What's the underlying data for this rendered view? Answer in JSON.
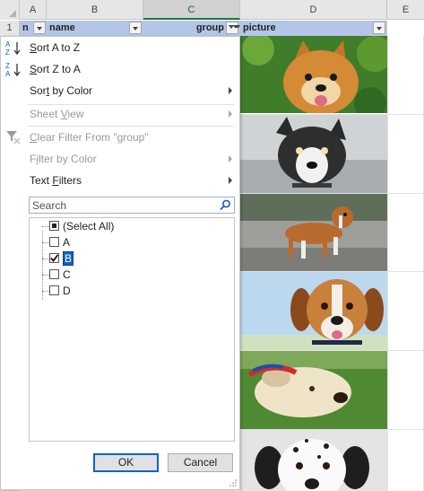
{
  "columns": [
    {
      "letter": ""
    },
    {
      "letter": "A"
    },
    {
      "letter": "B"
    },
    {
      "letter": "C"
    },
    {
      "letter": "D"
    },
    {
      "letter": "E"
    }
  ],
  "header_row": {
    "row_number": "1",
    "col_a": "n",
    "col_b": "name",
    "col_c": "group",
    "col_d": "picture"
  },
  "menu": {
    "sort_az": "Sort A to Z",
    "sort_za": "Sort Z to A",
    "sort_color": "Sort by Color",
    "sheet_view": "Sheet View",
    "clear_filter": "Clear Filter From \"group\"",
    "filter_color": "Filter by Color",
    "text_filters": "Text Filters",
    "search_placeholder": "Search",
    "items": [
      {
        "label": "(Select All)",
        "state": "indeterminate"
      },
      {
        "label": "A",
        "state": "unchecked"
      },
      {
        "label": "B",
        "state": "checked"
      },
      {
        "label": "C",
        "state": "unchecked"
      },
      {
        "label": "D",
        "state": "unchecked"
      }
    ],
    "ok": "OK",
    "cancel": "Cancel"
  },
  "pictures": [
    {
      "subject": "pomeranian-dog"
    },
    {
      "subject": "husky-mix-dog"
    },
    {
      "subject": "boxer-dog"
    },
    {
      "subject": "beagle-dog"
    },
    {
      "subject": "labrador-puppy"
    },
    {
      "subject": "dalmatian-dog"
    }
  ],
  "colors": {
    "header_fill": "#b4c6e7",
    "accent_green": "#217346",
    "selection_blue": "#0a64c8"
  }
}
